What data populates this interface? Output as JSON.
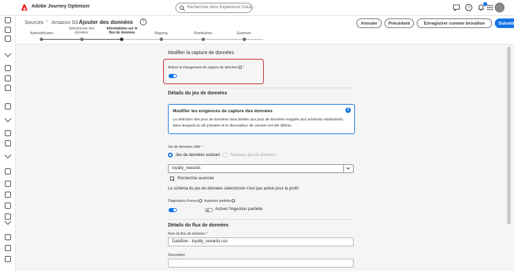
{
  "app": {
    "title": "Adobe Journey Optimizer",
    "brand_color": "#eb1000",
    "accent_color": "#1473e6"
  },
  "search": {
    "placeholder": "Rechercher dans Experience Cloud..."
  },
  "topbar_icons": [
    "chat-icon",
    "help-icon",
    "bell-icon",
    "apps-icon",
    "avatar"
  ],
  "breadcrumb": {
    "items": [
      "Sources",
      "Amazon S3"
    ],
    "current": "Ajouter des données",
    "help": "?"
  },
  "actions": {
    "cancel": "Annuler",
    "previous": "Précédent",
    "save_draft": "Enregistrer comme brouillon",
    "next": "Suivant"
  },
  "steps": [
    {
      "label": "Authentification",
      "active": false
    },
    {
      "label": "Sélectionner des données",
      "active": false
    },
    {
      "label": "Informations sur le flux de données",
      "active": true
    },
    {
      "label": "Mapping",
      "active": false
    },
    {
      "label": "Planification",
      "active": false
    },
    {
      "label": "Examiner",
      "active": false
    }
  ],
  "cdc": {
    "title": "Modifier la capture de données",
    "toggle_label": "Activer le changement de capture de données",
    "toggle_on": true
  },
  "dataset": {
    "title": "Détails du jeu de données",
    "info": {
      "title": "Modifier les exigences de capture des données",
      "line1": "La sélection des jeux de données sera limitée aux jeux de données mappés aux schémas relationnels,",
      "line2": "dans lesquels la clé primaire et le descripteur de version ont été définis."
    },
    "target_label": "Jeu de données cible",
    "option_existing": "Jeu de données existant",
    "option_new": "Nouveau jeu de données",
    "selected": "loyalty_rewards",
    "advanced_search": "Recherche avancée",
    "profile_note": "Le schéma du jeu de données sélectionné n'est pas activé pour le profil.",
    "error_diag_label": "Diagnostics d'erreur",
    "partial_ingest_label": "Ingestion partielle",
    "partial_ingest_toggle": "Activer l'ingestion partielle"
  },
  "dataflow": {
    "title": "Détails du flux de données",
    "name_label": "Nom du flux de données",
    "name_value": "Dataflow - loyalty_rewards.csv",
    "description_label": "Description",
    "description_value": ""
  },
  "required_marker": "*"
}
